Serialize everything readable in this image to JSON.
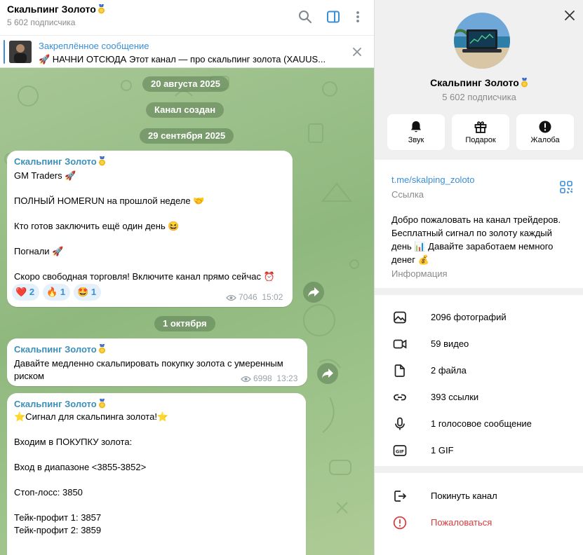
{
  "chat_header": {
    "title": "Скальпинг Золото",
    "subscribers": "5 602 подписчика",
    "icons": [
      "search-icon",
      "sidebar-toggle-icon",
      "more-vertical-icon"
    ]
  },
  "pinned": {
    "title": "Закреплённое сообщение",
    "text": "🚀 НАЧНИ ОТСЮДА  Этот канал — про скальпинг золота (XAUUS..."
  },
  "dates": [
    "20 августа 2025",
    "Канал создан",
    "29 сентября 2025",
    "1 октября"
  ],
  "messages": [
    {
      "author": "Скальпинг Золото",
      "lines": [
        "GM Traders 🚀",
        "ПОЛНЫЙ HOMERUN на прошлой неделе 🤝",
        "Кто готов заключить ещё один день 😆",
        "Погнали 🚀",
        "Скоро свободная торговля! Включите канал прямо сейчас ⏰"
      ],
      "reactions": [
        {
          "emoji": "❤️",
          "count": "2"
        },
        {
          "emoji": "🔥",
          "count": "1"
        },
        {
          "emoji": "🤩",
          "count": "1"
        }
      ],
      "views": "7046",
      "time": "15:02"
    },
    {
      "author": "Скальпинг Золото",
      "lines": [
        "Давайте медленно скальпировать покупку золота с умеренным",
        "риском"
      ],
      "views": "6998",
      "time": "13:23"
    },
    {
      "author": "Скальпинг Золото",
      "lines": [
        "⭐Сигнал для скальпинга золота!⭐",
        "Входим в ПОКУПКУ золота:",
        "Вход в диапазоне <3855-3852>",
        "Стоп-лосс: 3850",
        "Тейк-профит 1: 3857",
        "Тейк-профит 2: 3859"
      ]
    }
  ],
  "profile": {
    "name": "Скальпинг Золото",
    "subscribers": "5 602 подписчика",
    "buttons": [
      {
        "label": "Звук",
        "icon": "bell-icon"
      },
      {
        "label": "Подарок",
        "icon": "gift-icon"
      },
      {
        "label": "Жалоба",
        "icon": "report-icon"
      }
    ],
    "link": "t.me/skalping_zoloto",
    "link_label": "Ссылка",
    "description_lines": [
      "Добро пожаловать на канал трейдеров.",
      "Бесплатный сигнал по золоту каждый",
      "день 📊 Давайте заработаем немного",
      "денег 💰"
    ],
    "info_label": "Информация",
    "media": [
      {
        "label": "2096 фотографий",
        "icon": "photo-icon"
      },
      {
        "label": "59 видео",
        "icon": "video-icon"
      },
      {
        "label": "2 файла",
        "icon": "file-icon"
      },
      {
        "label": "393 ссылки",
        "icon": "link-icon"
      },
      {
        "label": "1 голосовое сообщение",
        "icon": "microphone-icon"
      },
      {
        "label": "1 GIF",
        "icon": "gif-icon"
      }
    ],
    "actions": [
      {
        "label": "Покинуть канал",
        "icon": "leave-icon"
      },
      {
        "label": "Пожаловаться",
        "icon": "report-icon",
        "color": "#d93a3a"
      }
    ]
  },
  "colors": {
    "accent": "#3a8ed6",
    "author": "#3a8fb8",
    "danger": "#d93a3a",
    "wallpaper": "#9cc28a"
  }
}
